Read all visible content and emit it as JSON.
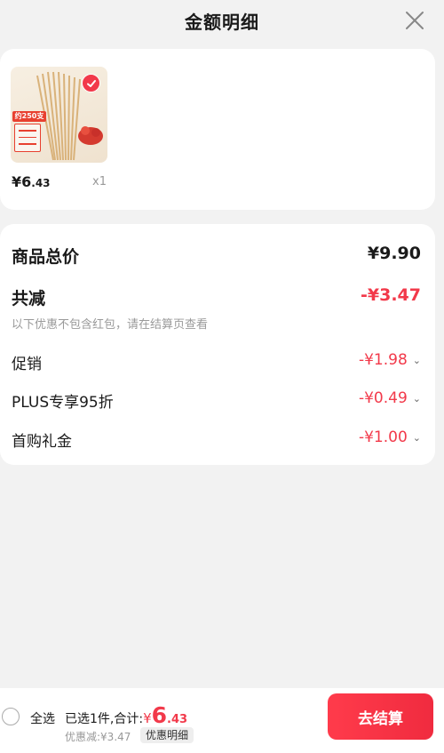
{
  "header": {
    "title": "金额明细",
    "close_icon": "close-icon"
  },
  "product": {
    "price_big": "¥6",
    "price_small": ".43",
    "qty": "x1",
    "selected": true,
    "thumb_tag": "约250支"
  },
  "breakdown": {
    "total_label": "商品总价",
    "total_value": "¥9.90",
    "discount_label": "共减",
    "discount_value": "-¥3.47",
    "note": "以下优惠不包含红包，请在结算页查看",
    "items": [
      {
        "label": "促销",
        "value": "-¥1.98"
      },
      {
        "label": "PLUS专享95折",
        "value": "-¥0.49"
      },
      {
        "label": "首购礼金",
        "value": "-¥1.00"
      }
    ]
  },
  "bottom": {
    "select_all": "全选",
    "summary_prefix": "已选1件,合计:",
    "currency": "¥",
    "total_big": "6",
    "total_small": ".43",
    "discount_line": "优惠减:¥3.47",
    "detail_chip": "优惠明细",
    "checkout": "去结算"
  },
  "colors": {
    "accent": "#f2394a",
    "background": "#f2f2f2"
  }
}
